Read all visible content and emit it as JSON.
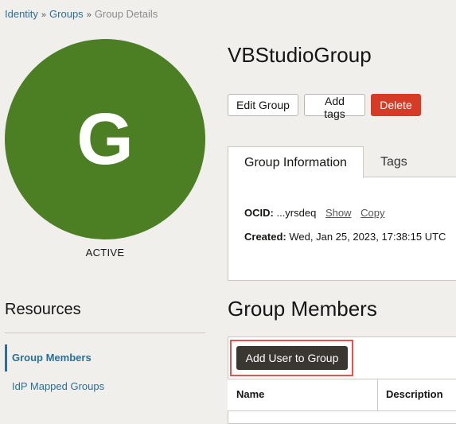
{
  "breadcrumb": {
    "identity": "Identity",
    "groups": "Groups",
    "current": "Group Details",
    "separator": "»"
  },
  "group": {
    "initial": "G",
    "status": "ACTIVE",
    "name": "VBStudioGroup",
    "avatar_color": "#4c7e24"
  },
  "actions": {
    "edit": "Edit Group",
    "add_tags": "Add tags",
    "delete": "Delete"
  },
  "tabs": {
    "info": "Group Information",
    "tags": "Tags"
  },
  "info": {
    "ocid_label": "OCID:",
    "ocid_value": "...yrsdeq",
    "show": "Show",
    "copy": "Copy",
    "created_label": "Created:",
    "created_value": "Wed, Jan 25, 2023, 17:38:15 UTC"
  },
  "resources": {
    "title": "Resources",
    "group_members": "Group Members",
    "idp_mapped": "IdP Mapped Groups"
  },
  "members": {
    "title": "Group Members",
    "add_button": "Add User to Group",
    "columns": {
      "name": "Name",
      "description": "Description"
    }
  },
  "colors": {
    "accent": "#2a6f97",
    "delete": "#d63b25",
    "highlight": "#e25454"
  }
}
